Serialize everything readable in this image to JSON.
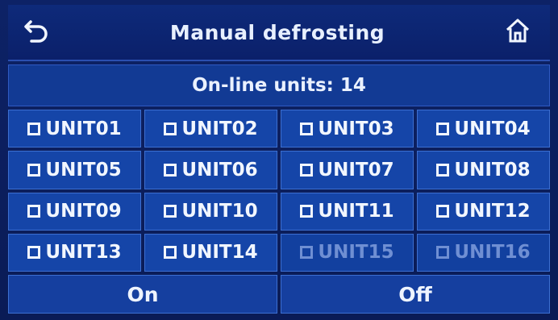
{
  "header": {
    "title": "Manual defrosting",
    "back_icon": "back-arrow-icon",
    "home_icon": "home-icon"
  },
  "info": {
    "online_units_text": "On-line units: 14"
  },
  "units": [
    {
      "label": "UNIT01",
      "enabled": true
    },
    {
      "label": "UNIT02",
      "enabled": true
    },
    {
      "label": "UNIT03",
      "enabled": true
    },
    {
      "label": "UNIT04",
      "enabled": true
    },
    {
      "label": "UNIT05",
      "enabled": true
    },
    {
      "label": "UNIT06",
      "enabled": true
    },
    {
      "label": "UNIT07",
      "enabled": true
    },
    {
      "label": "UNIT08",
      "enabled": true
    },
    {
      "label": "UNIT09",
      "enabled": true
    },
    {
      "label": "UNIT10",
      "enabled": true
    },
    {
      "label": "UNIT11",
      "enabled": true
    },
    {
      "label": "UNIT12",
      "enabled": true
    },
    {
      "label": "UNIT13",
      "enabled": true
    },
    {
      "label": "UNIT14",
      "enabled": true
    },
    {
      "label": "UNIT15",
      "enabled": false
    },
    {
      "label": "UNIT16",
      "enabled": false
    }
  ],
  "footer": {
    "on_label": "On",
    "off_label": "Off"
  },
  "colors": {
    "background": "#0b1a4a",
    "panel": "#1545a8",
    "text": "#f1f6ff",
    "disabled_text": "#6f8fd3"
  }
}
